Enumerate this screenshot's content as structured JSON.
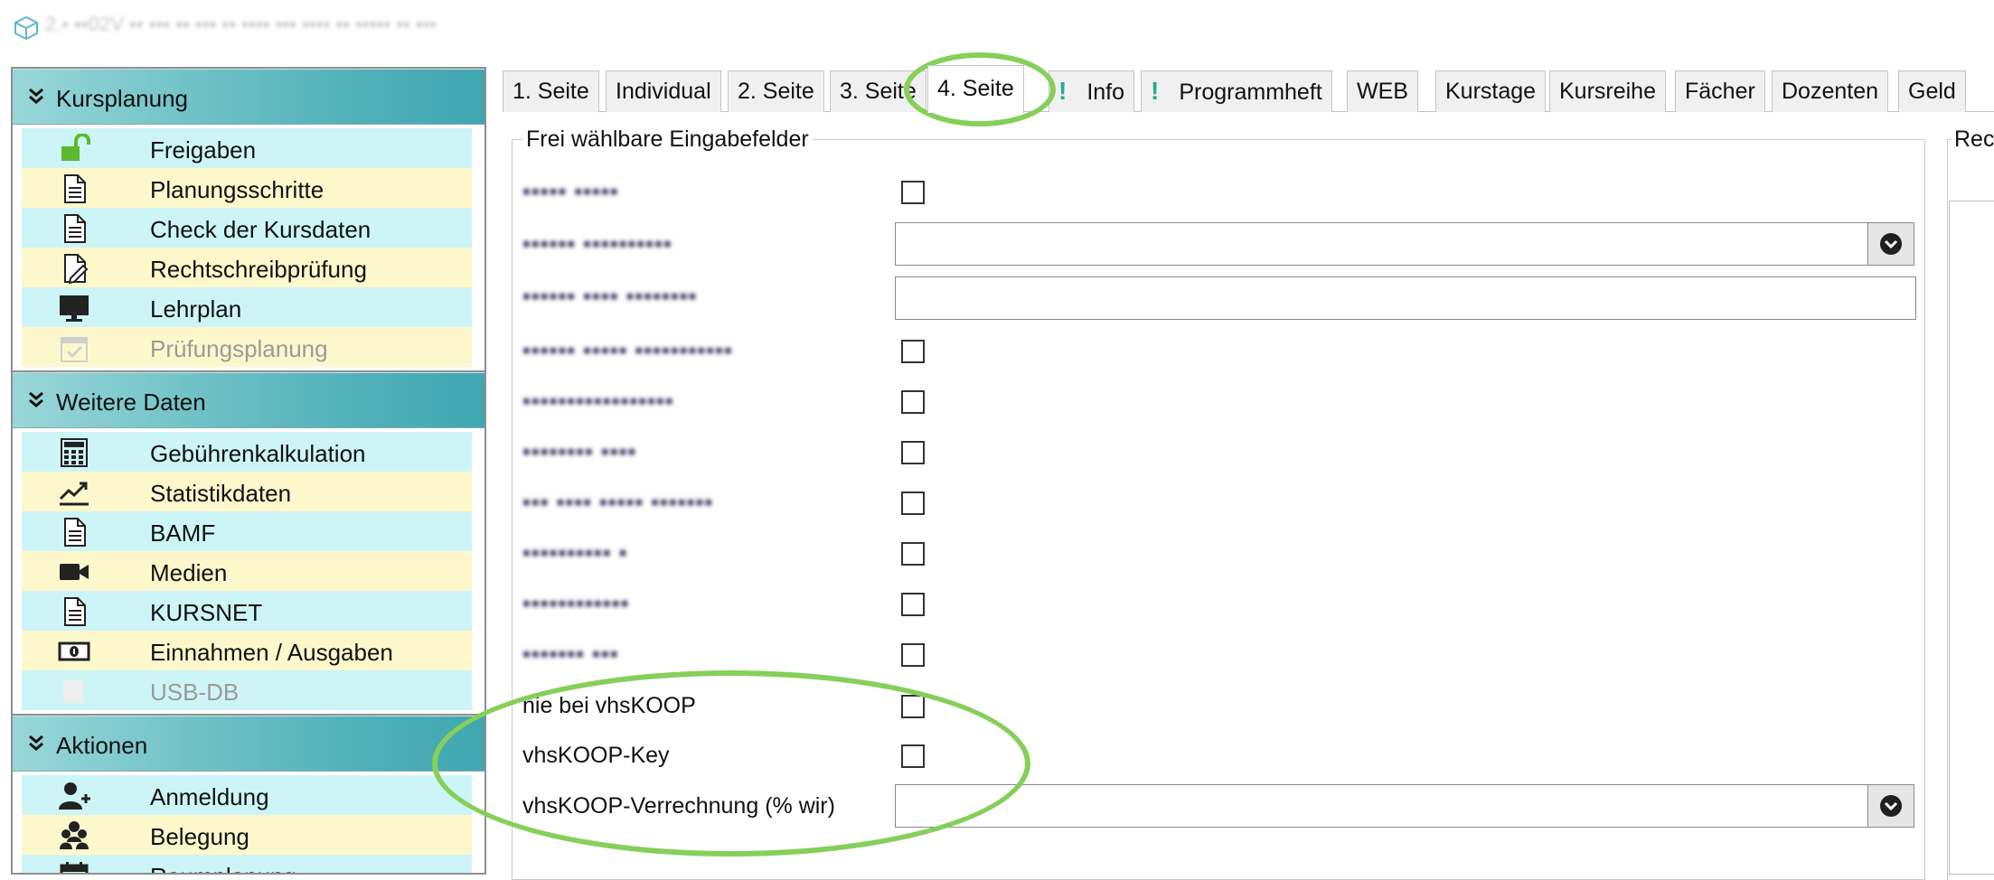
{
  "window": {
    "title": "2.▪ ▪▪02V ▪▪ ▪▪▪ ▪▪ ▪▪▪ ▪▪ ▪▪▪▪ ▪▪▪ ▪▪▪▪ ▪▪ ▪▪▪▪▪ ▪▪ ▪▪▪"
  },
  "sidebar": {
    "sections": [
      {
        "label": "Kursplanung",
        "items": [
          {
            "label": "Freigaben",
            "icon": "unlock-icon"
          },
          {
            "label": "Planungsschritte",
            "icon": "document-icon"
          },
          {
            "label": "Check der Kursdaten",
            "icon": "document-icon"
          },
          {
            "label": "Rechtschreibprüfung",
            "icon": "document-edit-icon"
          },
          {
            "label": "Lehrplan",
            "icon": "monitor-icon"
          },
          {
            "label": "Prüfungsplanung",
            "icon": "calendar-check-icon",
            "disabled": true
          }
        ]
      },
      {
        "label": "Weitere Daten",
        "items": [
          {
            "label": "Gebührenkalkulation",
            "icon": "calculator-icon"
          },
          {
            "label": "Statistikdaten",
            "icon": "chart-line-icon"
          },
          {
            "label": "BAMF",
            "icon": "document-icon"
          },
          {
            "label": "Medien",
            "icon": "video-camera-icon"
          },
          {
            "label": "KURSNET",
            "icon": "document-icon"
          },
          {
            "label": "Einnahmen / Ausgaben",
            "icon": "money-icon"
          },
          {
            "label": "USB-DB",
            "icon": "usb-icon",
            "disabled": true
          }
        ]
      },
      {
        "label": "Aktionen",
        "items": [
          {
            "label": "Anmeldung",
            "icon": "user-add-icon"
          },
          {
            "label": "Belegung",
            "icon": "users-icon"
          },
          {
            "label": "Raumplanung",
            "icon": "calendar-icon"
          }
        ]
      }
    ]
  },
  "tabs": [
    {
      "label": "1. Seite"
    },
    {
      "label": "Individual"
    },
    {
      "label": "2. Seite"
    },
    {
      "label": "3. Seite"
    },
    {
      "label": "4. Seite",
      "active": true
    },
    {
      "label": "Info",
      "marker": "!"
    },
    {
      "label": "Programmheft",
      "marker": "!"
    },
    {
      "label": "WEB"
    },
    {
      "label": "Kurstage"
    },
    {
      "label": "Kursreihe"
    },
    {
      "label": "Fächer"
    },
    {
      "label": "Dozenten"
    },
    {
      "label": "Geld"
    }
  ],
  "groupbox": {
    "title": "Frei wählbare Eingabefelder",
    "fields": [
      {
        "label": "▪▪▪▪▪ ▪▪▪▪▪",
        "type": "checkbox",
        "blurred": true
      },
      {
        "label": "▪▪▪▪▪▪ ▪▪▪▪▪▪▪▪▪▪",
        "type": "combo",
        "blurred": true
      },
      {
        "label": "▪▪▪▪▪▪ ▪▪▪▪ ▪▪▪▪▪▪▪▪",
        "type": "text",
        "blurred": true
      },
      {
        "label": "▪▪▪▪▪▪ ▪▪▪▪▪ ▪▪▪▪▪▪▪▪▪▪▪",
        "type": "checkbox",
        "blurred": true
      },
      {
        "label": "▪▪▪▪▪▪▪▪▪▪▪▪▪▪▪▪▪",
        "type": "checkbox",
        "blurred": true
      },
      {
        "label": "▪▪▪▪▪▪▪▪ ▪▪▪▪",
        "type": "checkbox",
        "blurred": true
      },
      {
        "label": "▪▪▪ ▪▪▪▪ ▪▪▪▪▪ ▪▪▪▪▪▪▪",
        "type": "checkbox",
        "blurred": true
      },
      {
        "label": "▪▪▪▪▪▪▪▪▪▪ ▪",
        "type": "checkbox",
        "blurred": true
      },
      {
        "label": "▪▪▪▪▪▪▪▪▪▪▪▪",
        "type": "checkbox",
        "blurred": true
      },
      {
        "label": "▪▪▪▪▪▪▪ ▪▪▪",
        "type": "checkbox",
        "blurred": true
      },
      {
        "label": "nie bei vhsKOOP",
        "type": "checkbox"
      },
      {
        "label": "vhsKOOP-Key",
        "type": "checkbox"
      },
      {
        "label": "vhsKOOP-Verrechnung (% wir)",
        "type": "combo"
      }
    ]
  },
  "right_group": {
    "title": "Rec"
  },
  "colors": {
    "highlight": "#86cf5a",
    "item_cyan": "#cdf5f7",
    "item_yellow": "#fdf8cc",
    "header_teal": "#4fb0b8"
  }
}
